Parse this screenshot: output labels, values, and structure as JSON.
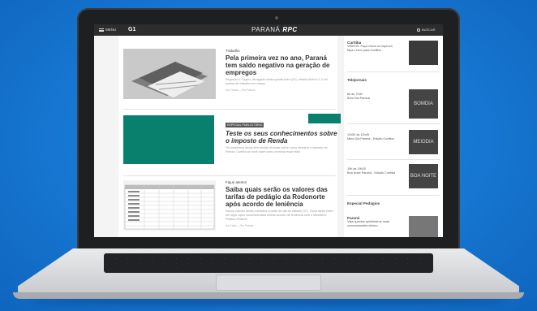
{
  "nav": {
    "menu_label": "MENU",
    "g1_label": "G1",
    "brand_left": "PARANÁ",
    "brand_right": "RPC",
    "search_label": "BUSCAR"
  },
  "stories": [
    {
      "kicker": "Trabalho",
      "headline": "Pela primeira vez no ano, Paraná tem saldo negativo na geração de empregos",
      "summary": "Segundo o Caged, divulgado nesta quarta-feira (24), estado fechou 1,2 mil postos de trabalho em março.",
      "meta": "Há 2 horas — Em Paraná"
    },
    {
      "badge": "ESPECIAL PUBLICITÁRIO",
      "headline": "Teste os seus conhecimentos sobre o imposto de Renda",
      "summary": "Os brasileiros ainda têm muitas dúvidas sobre como declarar o imposto de Renda. Confira se você sabe como dominar esse leão!"
    },
    {
      "kicker": "Fique atento!",
      "headline": "Saiba quais serão os valores das tarifas de pedágio da Rodonorte após acordo de leniência",
      "summary": "Novos valores serão cobrados a partir do dia de sábado (27). Nova tarifa entra em vigor após concessionária fechar acordo de leniência com o Ministério Público Federal.",
      "meta": "Há 3 dias — Em Paraná"
    }
  ],
  "sidebar": {
    "top": {
      "title": "Curitiba",
      "text": "VÍDEOS: Faça chuva ou faça sol, faça o bem para Curitiba"
    },
    "telejornais_heading": "Telejornais",
    "shows": [
      {
        "time": "6h às 7h30",
        "name": "Bom Dia Paraná",
        "logo": "BOMDIA"
      },
      {
        "time": "11h50 às 12h45",
        "name": "Meio-Dia Paraná - Edição Curitiba",
        "logo": "MEIODIA"
      },
      {
        "time": "19h às 19h20",
        "name": "Boa Noite Paraná - Edição Curitiba",
        "logo": "BOA NOITE"
      }
    ],
    "especial_heading": "Especial Pedágios",
    "especial": {
      "title": "Paraná",
      "text": "Veja quantos quilômetros cada concessionária deixou"
    }
  }
}
